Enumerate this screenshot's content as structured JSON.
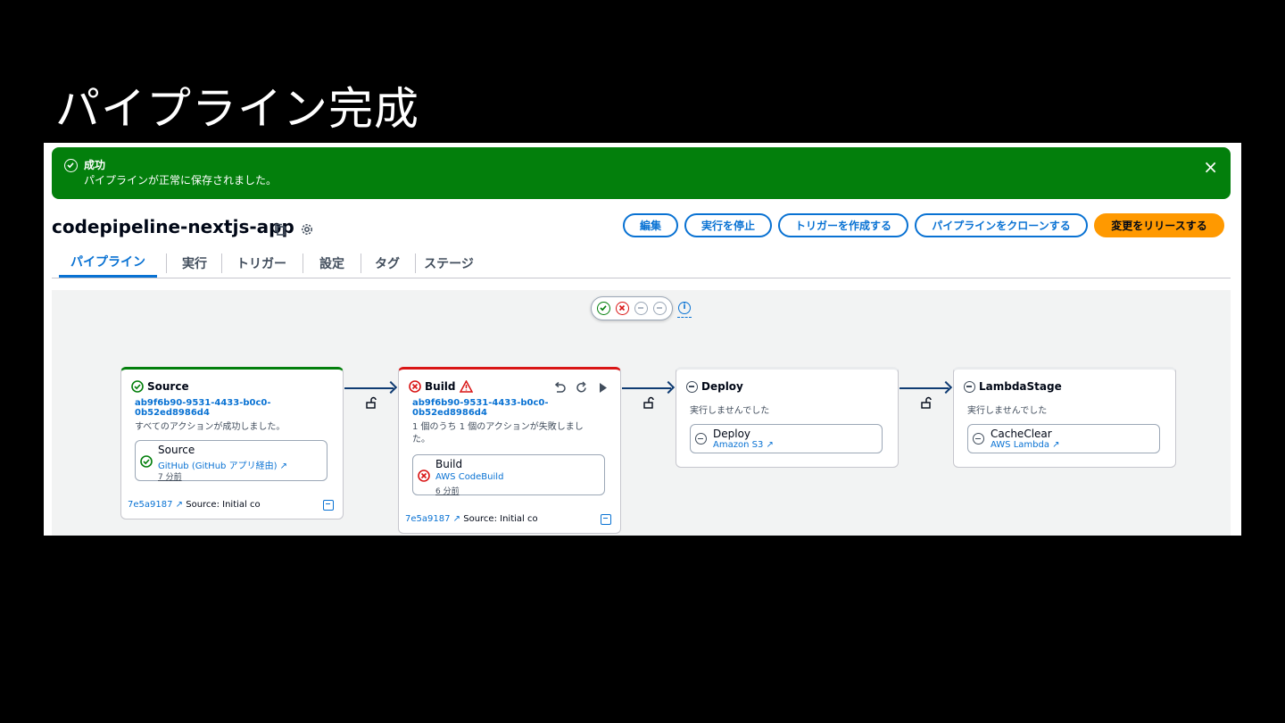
{
  "slide_title": "パイプライン完成",
  "flash": {
    "title": "成功",
    "message": "パイプラインが正常に保存されました。",
    "close": "×"
  },
  "pipeline": {
    "name": "codepipeline-nextjs-app"
  },
  "header_buttons": {
    "edit": "編集",
    "stop": "実行を停止",
    "create_trigger": "トリガーを作成する",
    "clone": "パイプラインをクローンする",
    "release": "変更をリリースする"
  },
  "tabs": [
    "パイプライン",
    "実行",
    "トリガー",
    "設定",
    "タグ",
    "ステージ"
  ],
  "colors": {
    "success": "#037f0c",
    "error": "#d91515",
    "link": "#0972d3",
    "primary_button": "#ff9900"
  },
  "stages": {
    "source": {
      "name": "Source",
      "execution_id": "ab9f6b90-9531-4433-b0c0-0b52ed8986d4",
      "message": "すべてのアクションが成功しました。",
      "action_name": "Source",
      "action_provider": "GitHub (GitHub アプリ経由)",
      "action_time": "7 分前",
      "commit_id": "7e5a9187",
      "commit_msg": "Source: Initial co"
    },
    "build": {
      "name": "Build",
      "execution_id": "ab9f6b90-9531-4433-b0c0-0b52ed8986d4",
      "message": "1 個のうち 1 個のアクションが失敗しました。",
      "action_name": "Build",
      "action_provider": "AWS CodeBuild",
      "action_time": "6 分前",
      "commit_id": "7e5a9187",
      "commit_msg": "Source: Initial co"
    },
    "deploy": {
      "name": "Deploy",
      "message": "実行しませんでした",
      "action_name": "Deploy",
      "action_provider": "Amazon S3"
    },
    "lambda": {
      "name": "LambdaStage",
      "message": "実行しませんでした",
      "action_name": "CacheClear",
      "action_provider": "AWS Lambda"
    }
  }
}
